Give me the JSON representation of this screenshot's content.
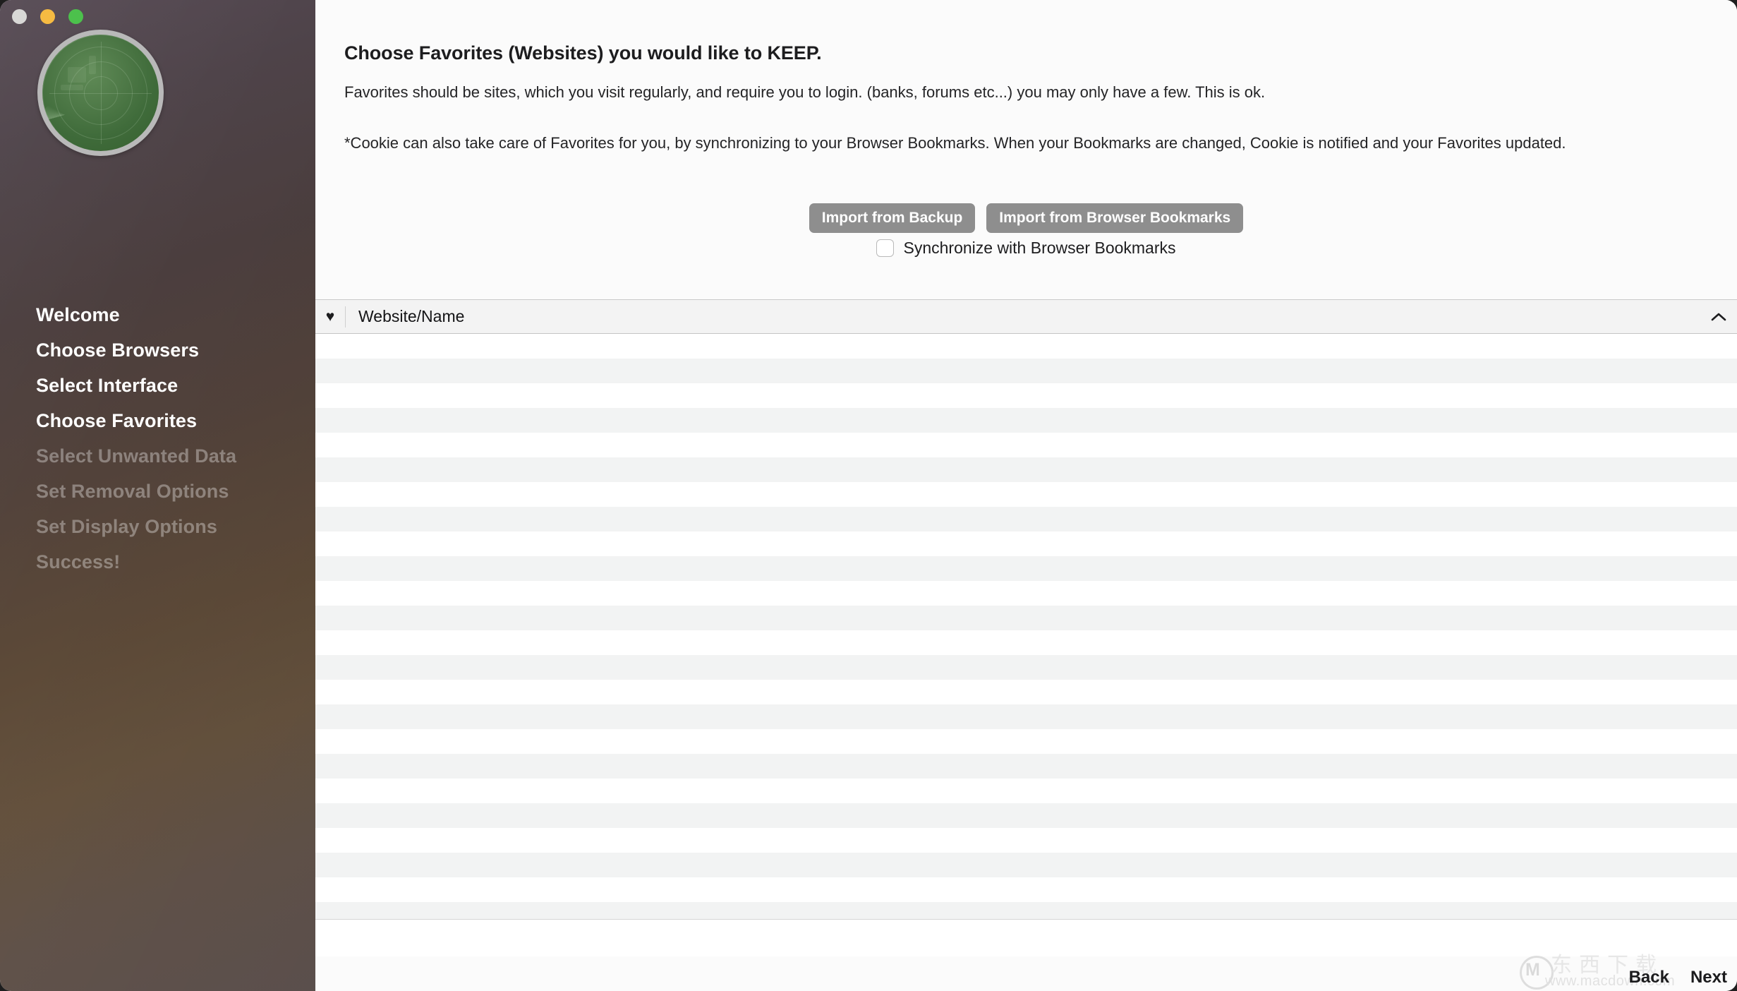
{
  "window": {
    "traffic_lights": [
      {
        "name": "close",
        "color": "#d8d8d6"
      },
      {
        "name": "minimize",
        "color": "#f6bb42"
      },
      {
        "name": "maximize",
        "color": "#4cc14c"
      }
    ]
  },
  "sidebar": {
    "logo_name": "radar-scope-logo",
    "items": [
      {
        "label": "Welcome",
        "state": "active"
      },
      {
        "label": "Choose Browsers",
        "state": "active"
      },
      {
        "label": "Select Interface",
        "state": "active"
      },
      {
        "label": "Choose Favorites",
        "state": "active"
      },
      {
        "label": "Select Unwanted Data",
        "state": "inactive"
      },
      {
        "label": "Set Removal Options",
        "state": "inactive"
      },
      {
        "label": "Set Display Options",
        "state": "inactive"
      },
      {
        "label": "Success!",
        "state": "inactive"
      }
    ]
  },
  "main": {
    "headline": "Choose Favorites (Websites) you would like to KEEP.",
    "paragraph1": "Favorites should be sites, which you visit regularly, and require you to login. (banks, forums etc...) you may only have a few. This is ok.",
    "paragraph2": "*Cookie can also take care of Favorites for you, by synchronizing to your Browser Bookmarks. When your Bookmarks are changed, Cookie is notified and your Favorites updated.",
    "import_backup_label": "Import from Backup",
    "import_bookmarks_label": "Import from Browser Bookmarks",
    "sync_checkbox_label": "Synchronize with Browser Bookmarks",
    "sync_checkbox_checked": false
  },
  "table": {
    "favorite_column_icon": "heart-icon",
    "favorite_column_glyph": "♥",
    "name_column_header": "Website/Name",
    "sort_direction": "ascending",
    "row_count": 25,
    "rows": []
  },
  "footer": {
    "back_label": "Back",
    "next_label": "Next",
    "watermark_url": "www.macdown.com",
    "watermark_mark": "M",
    "watermark_cjk": "东西下载"
  },
  "colors": {
    "button_gray": "#8e8e8e",
    "sidebar_top": "#564a54",
    "sidebar_bottom": "#5f5350",
    "scope_green": "#4f7a48",
    "row_alt": "#f2f3f3",
    "header_bg": "#f3f3f3"
  }
}
